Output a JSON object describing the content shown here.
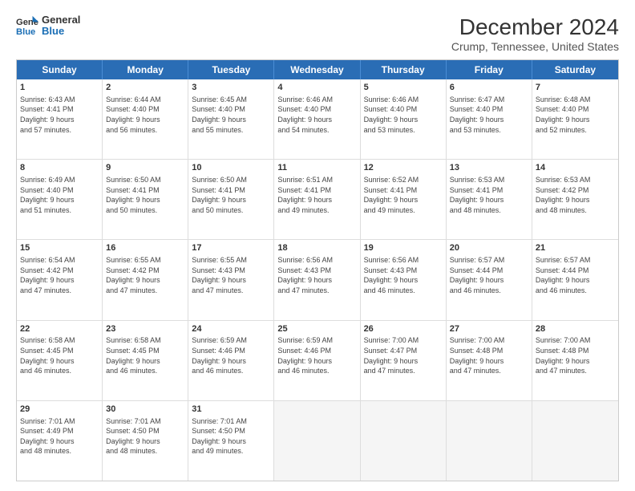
{
  "logo": {
    "line1": "General",
    "line2": "Blue"
  },
  "title": "December 2024",
  "subtitle": "Crump, Tennessee, United States",
  "header_days": [
    "Sunday",
    "Monday",
    "Tuesday",
    "Wednesday",
    "Thursday",
    "Friday",
    "Saturday"
  ],
  "weeks": [
    [
      {
        "day": "1",
        "lines": [
          "Sunrise: 6:43 AM",
          "Sunset: 4:41 PM",
          "Daylight: 9 hours",
          "and 57 minutes."
        ]
      },
      {
        "day": "2",
        "lines": [
          "Sunrise: 6:44 AM",
          "Sunset: 4:40 PM",
          "Daylight: 9 hours",
          "and 56 minutes."
        ]
      },
      {
        "day": "3",
        "lines": [
          "Sunrise: 6:45 AM",
          "Sunset: 4:40 PM",
          "Daylight: 9 hours",
          "and 55 minutes."
        ]
      },
      {
        "day": "4",
        "lines": [
          "Sunrise: 6:46 AM",
          "Sunset: 4:40 PM",
          "Daylight: 9 hours",
          "and 54 minutes."
        ]
      },
      {
        "day": "5",
        "lines": [
          "Sunrise: 6:46 AM",
          "Sunset: 4:40 PM",
          "Daylight: 9 hours",
          "and 53 minutes."
        ]
      },
      {
        "day": "6",
        "lines": [
          "Sunrise: 6:47 AM",
          "Sunset: 4:40 PM",
          "Daylight: 9 hours",
          "and 53 minutes."
        ]
      },
      {
        "day": "7",
        "lines": [
          "Sunrise: 6:48 AM",
          "Sunset: 4:40 PM",
          "Daylight: 9 hours",
          "and 52 minutes."
        ]
      }
    ],
    [
      {
        "day": "8",
        "lines": [
          "Sunrise: 6:49 AM",
          "Sunset: 4:40 PM",
          "Daylight: 9 hours",
          "and 51 minutes."
        ]
      },
      {
        "day": "9",
        "lines": [
          "Sunrise: 6:50 AM",
          "Sunset: 4:41 PM",
          "Daylight: 9 hours",
          "and 50 minutes."
        ]
      },
      {
        "day": "10",
        "lines": [
          "Sunrise: 6:50 AM",
          "Sunset: 4:41 PM",
          "Daylight: 9 hours",
          "and 50 minutes."
        ]
      },
      {
        "day": "11",
        "lines": [
          "Sunrise: 6:51 AM",
          "Sunset: 4:41 PM",
          "Daylight: 9 hours",
          "and 49 minutes."
        ]
      },
      {
        "day": "12",
        "lines": [
          "Sunrise: 6:52 AM",
          "Sunset: 4:41 PM",
          "Daylight: 9 hours",
          "and 49 minutes."
        ]
      },
      {
        "day": "13",
        "lines": [
          "Sunrise: 6:53 AM",
          "Sunset: 4:41 PM",
          "Daylight: 9 hours",
          "and 48 minutes."
        ]
      },
      {
        "day": "14",
        "lines": [
          "Sunrise: 6:53 AM",
          "Sunset: 4:42 PM",
          "Daylight: 9 hours",
          "and 48 minutes."
        ]
      }
    ],
    [
      {
        "day": "15",
        "lines": [
          "Sunrise: 6:54 AM",
          "Sunset: 4:42 PM",
          "Daylight: 9 hours",
          "and 47 minutes."
        ]
      },
      {
        "day": "16",
        "lines": [
          "Sunrise: 6:55 AM",
          "Sunset: 4:42 PM",
          "Daylight: 9 hours",
          "and 47 minutes."
        ]
      },
      {
        "day": "17",
        "lines": [
          "Sunrise: 6:55 AM",
          "Sunset: 4:43 PM",
          "Daylight: 9 hours",
          "and 47 minutes."
        ]
      },
      {
        "day": "18",
        "lines": [
          "Sunrise: 6:56 AM",
          "Sunset: 4:43 PM",
          "Daylight: 9 hours",
          "and 47 minutes."
        ]
      },
      {
        "day": "19",
        "lines": [
          "Sunrise: 6:56 AM",
          "Sunset: 4:43 PM",
          "Daylight: 9 hours",
          "and 46 minutes."
        ]
      },
      {
        "day": "20",
        "lines": [
          "Sunrise: 6:57 AM",
          "Sunset: 4:44 PM",
          "Daylight: 9 hours",
          "and 46 minutes."
        ]
      },
      {
        "day": "21",
        "lines": [
          "Sunrise: 6:57 AM",
          "Sunset: 4:44 PM",
          "Daylight: 9 hours",
          "and 46 minutes."
        ]
      }
    ],
    [
      {
        "day": "22",
        "lines": [
          "Sunrise: 6:58 AM",
          "Sunset: 4:45 PM",
          "Daylight: 9 hours",
          "and 46 minutes."
        ]
      },
      {
        "day": "23",
        "lines": [
          "Sunrise: 6:58 AM",
          "Sunset: 4:45 PM",
          "Daylight: 9 hours",
          "and 46 minutes."
        ]
      },
      {
        "day": "24",
        "lines": [
          "Sunrise: 6:59 AM",
          "Sunset: 4:46 PM",
          "Daylight: 9 hours",
          "and 46 minutes."
        ]
      },
      {
        "day": "25",
        "lines": [
          "Sunrise: 6:59 AM",
          "Sunset: 4:46 PM",
          "Daylight: 9 hours",
          "and 46 minutes."
        ]
      },
      {
        "day": "26",
        "lines": [
          "Sunrise: 7:00 AM",
          "Sunset: 4:47 PM",
          "Daylight: 9 hours",
          "and 47 minutes."
        ]
      },
      {
        "day": "27",
        "lines": [
          "Sunrise: 7:00 AM",
          "Sunset: 4:48 PM",
          "Daylight: 9 hours",
          "and 47 minutes."
        ]
      },
      {
        "day": "28",
        "lines": [
          "Sunrise: 7:00 AM",
          "Sunset: 4:48 PM",
          "Daylight: 9 hours",
          "and 47 minutes."
        ]
      }
    ],
    [
      {
        "day": "29",
        "lines": [
          "Sunrise: 7:01 AM",
          "Sunset: 4:49 PM",
          "Daylight: 9 hours",
          "and 48 minutes."
        ]
      },
      {
        "day": "30",
        "lines": [
          "Sunrise: 7:01 AM",
          "Sunset: 4:50 PM",
          "Daylight: 9 hours",
          "and 48 minutes."
        ]
      },
      {
        "day": "31",
        "lines": [
          "Sunrise: 7:01 AM",
          "Sunset: 4:50 PM",
          "Daylight: 9 hours",
          "and 49 minutes."
        ]
      },
      {
        "day": "",
        "lines": []
      },
      {
        "day": "",
        "lines": []
      },
      {
        "day": "",
        "lines": []
      },
      {
        "day": "",
        "lines": []
      }
    ]
  ]
}
